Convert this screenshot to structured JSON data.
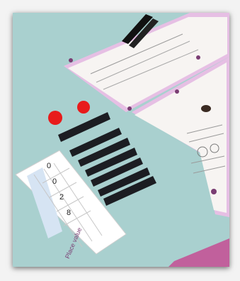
{
  "photo": {
    "description_icon": "photo-icon",
    "table_color": "#a9d0cf",
    "worksheet_border_color": "#e6bfe4"
  },
  "place_value_chart": {
    "label": "Place value",
    "digits": [
      "0",
      "0",
      "2",
      "8"
    ]
  },
  "counters": {
    "count": 2,
    "color": "#e81b1b"
  },
  "rods": {
    "count": 7,
    "color": "#1c1d22"
  }
}
